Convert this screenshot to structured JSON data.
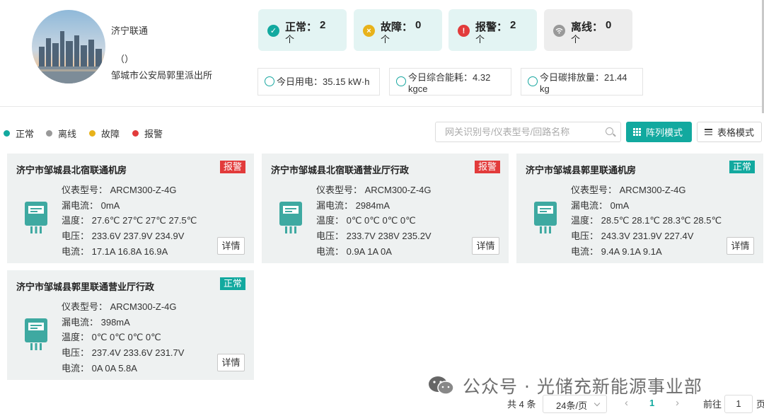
{
  "profile": {
    "name": "济宁联通",
    "paren": "（）",
    "address": "邹城市公安局郭里派出所"
  },
  "stats": [
    {
      "label": "正常：",
      "value": "2",
      "unit": "个",
      "icon": "check-circle-icon",
      "color": "#12a99f"
    },
    {
      "label": "故障：",
      "value": "0",
      "unit": "个",
      "icon": "fault-x-icon",
      "color": "#e8b21a"
    },
    {
      "label": "报警：",
      "value": "2",
      "unit": "个",
      "icon": "alarm-exclamation-icon",
      "color": "#e23b3b"
    },
    {
      "label": "离线：",
      "value": "0",
      "unit": "个",
      "icon": "wifi-offline-icon",
      "color": "#999999"
    }
  ],
  "energy": {
    "power": "今日用电：35.15 kW·h",
    "consumption_line1": "今日综合能耗：4.32",
    "consumption_line2": "kgce",
    "carbon_line1": "今日碳排放量：21.44",
    "carbon_line2": "kg"
  },
  "legend": [
    {
      "label": "正常",
      "color": "#12a99f"
    },
    {
      "label": "离线",
      "color": "#999999"
    },
    {
      "label": "故障",
      "color": "#e8b21a"
    },
    {
      "label": "报警",
      "color": "#e23b3b"
    }
  ],
  "search": {
    "placeholder": "网关识别号/仪表型号/回路名称"
  },
  "modes": {
    "array": "阵列模式",
    "table": "表格模式"
  },
  "cards": [
    {
      "title": "济宁市邹城县北宿联通机房",
      "status": "报警",
      "model": "仪表型号：  ARCM300-Z-4G",
      "leak": "漏电流：  0mA",
      "temp": "温度：  27.6℃ 27℃ 27℃ 27.5℃",
      "voltage": "电压：  233.6V 237.9V 234.9V",
      "current": "电流：  17.1A 16.8A 16.9A",
      "detail": "详情"
    },
    {
      "title": "济宁市邹城县北宿联通营业厅行政",
      "status": "报警",
      "model": "仪表型号：  ARCM300-Z-4G",
      "leak": "漏电流：  2984mA",
      "temp": "温度：  0℃ 0℃ 0℃ 0℃",
      "voltage": "电压：  233.7V 238V 235.2V",
      "current": "电流：  0.9A 1A 0A",
      "detail": "详情"
    },
    {
      "title": "济宁市邹城县郭里联通机房",
      "status": "正常",
      "model": "仪表型号：  ARCM300-Z-4G",
      "leak": "漏电流：  0mA",
      "temp": "温度：  28.5℃ 28.1℃ 28.3℃ 28.5℃",
      "voltage": "电压：  243.3V 231.9V 227.4V",
      "current": "电流：  9.4A 9.1A 9.1A",
      "detail": "详情"
    },
    {
      "title": "济宁市邹城县郭里联通营业厅行政",
      "status": "正常",
      "model": "仪表型号：  ARCM300-Z-4G",
      "leak": "漏电流：  398mA",
      "temp": "温度：  0℃ 0℃ 0℃ 0℃",
      "voltage": "电压：  237.4V 233.6V 231.7V",
      "current": "电流：  0A 0A 5.8A",
      "detail": "详情"
    }
  ],
  "pagination": {
    "total": "共 4 条",
    "page_size": "24条/页",
    "current": "1",
    "goto": "前往",
    "goto_value": "1",
    "page_suffix": "页"
  },
  "watermark": {
    "text": "公众号 · 光储充新能源事业部"
  }
}
